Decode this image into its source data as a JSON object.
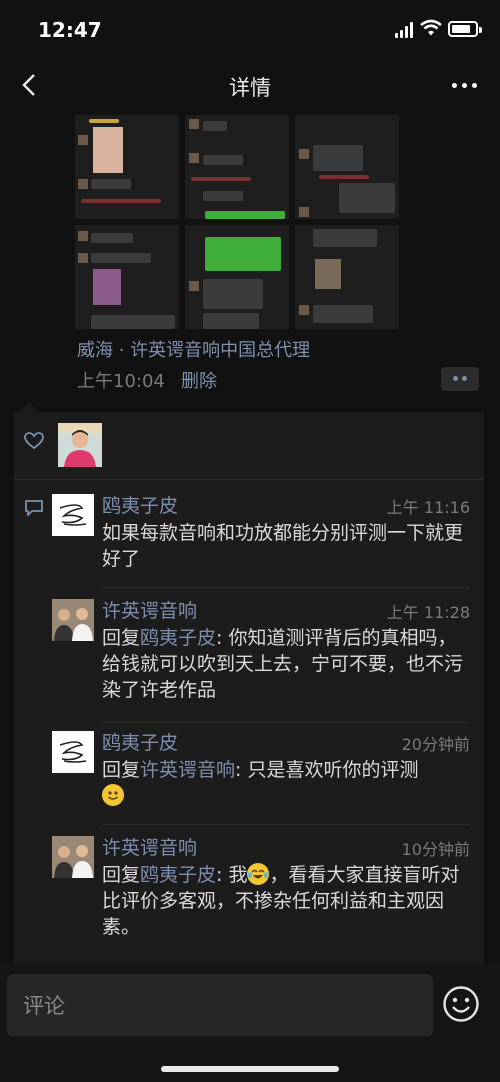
{
  "status_bar": {
    "time": "12:47"
  },
  "nav": {
    "title": "详情"
  },
  "post": {
    "location": "威海 · 许英谔音响中国总代理",
    "time": "上午10:04",
    "delete_label": "删除"
  },
  "comments": [
    {
      "name": "鸥夷子皮",
      "time": "上午 11:16",
      "text": "如果每款音响和功放都能分别评测一下就更好了"
    },
    {
      "name": "许英谔音响",
      "time": "上午 11:28",
      "reply_prefix": "回复",
      "reply_to": "鸥夷子皮",
      "text": ": 你知道测评背后的真相吗，给钱就可以吹到天上去，宁可不要，也不污染了许老作品"
    },
    {
      "name": "鸥夷子皮",
      "time": "20分钟前",
      "reply_prefix": "回复",
      "reply_to": "许英谔音响",
      "text": ": 只是喜欢听你的评测"
    },
    {
      "name": "许英谔音响",
      "time": "10分钟前",
      "reply_prefix": "回复",
      "reply_to": "鸥夷子皮",
      "text_a": ": 我",
      "text_b": "，看看大家直接盲听对比评价多客观，不掺杂任何利益和主观因素。"
    }
  ],
  "input": {
    "placeholder": "评论"
  }
}
